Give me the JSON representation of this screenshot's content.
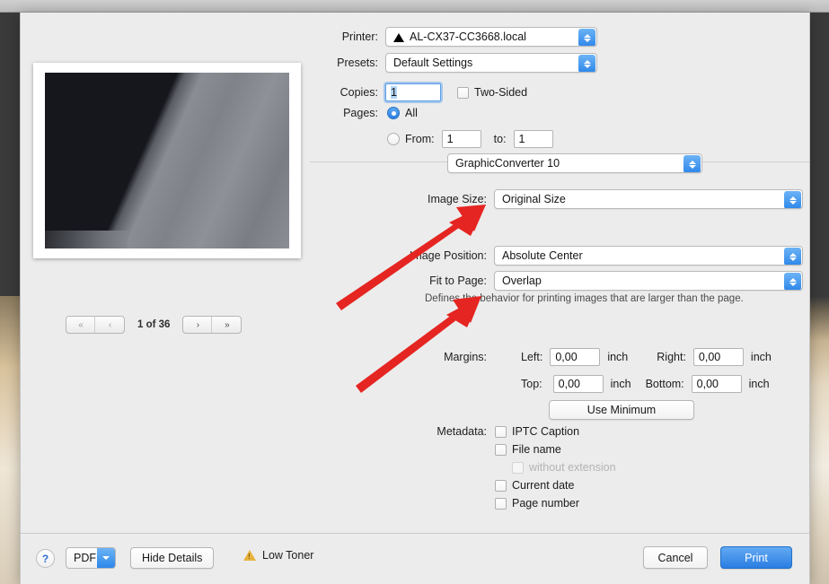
{
  "dialog": {
    "printer": {
      "label": "Printer:",
      "value": "AL-CX37-CC3668.local",
      "warning_icon": "warning-triangle-icon"
    },
    "presets": {
      "label": "Presets:",
      "value": "Default Settings"
    },
    "copies": {
      "label": "Copies:",
      "value": "1"
    },
    "two_sided": {
      "label": "Two-Sided",
      "checked": false
    },
    "pages": {
      "label": "Pages:",
      "all_label": "All",
      "all_selected": true,
      "from_label": "From:",
      "from_value": "1",
      "to_label": "to:",
      "to_value": "1",
      "range_selected": false
    },
    "module": {
      "value": "GraphicConverter 10"
    },
    "image_size": {
      "label": "Image Size:",
      "value": "Original Size"
    },
    "image_position": {
      "label": "Image Position:",
      "value": "Absolute Center"
    },
    "fit_to_page": {
      "label": "Fit to Page:",
      "value": "Overlap"
    },
    "fit_hint": "Defines the behavior for printing images that are larger than the page.",
    "margins": {
      "label": "Margins:",
      "left_label": "Left:",
      "left_value": "0,00",
      "left_unit": "inch",
      "right_label": "Right:",
      "right_value": "0,00",
      "right_unit": "inch",
      "top_label": "Top:",
      "top_value": "0,00",
      "top_unit": "inch",
      "bottom_label": "Bottom:",
      "bottom_value": "0,00",
      "bottom_unit": "inch",
      "use_minimum_label": "Use Minimum"
    },
    "metadata": {
      "label": "Metadata:",
      "items": [
        {
          "label": "IPTC Caption",
          "checked": false,
          "disabled": false
        },
        {
          "label": "File name",
          "checked": false,
          "disabled": false
        },
        {
          "label": "without extension",
          "checked": false,
          "disabled": true
        },
        {
          "label": "Current date",
          "checked": false,
          "disabled": false
        },
        {
          "label": "Page number",
          "checked": false,
          "disabled": false
        }
      ]
    }
  },
  "preview": {
    "page_counter": "1 of 36",
    "first_label": "«",
    "prev_label": "‹",
    "next_label": "›",
    "last_label": "»"
  },
  "bottom": {
    "help_label": "?",
    "pdf_label": "PDF",
    "hide_details_label": "Hide Details",
    "toner_label": "Low Toner",
    "cancel_label": "Cancel",
    "print_label": "Print"
  },
  "colors": {
    "accent_blue": "#2d87ea",
    "print_button_blue": "#2a7de2",
    "warning_amber": "#e8b33c",
    "annotation_red": "#e52521",
    "dialog_bg": "#ececec"
  }
}
